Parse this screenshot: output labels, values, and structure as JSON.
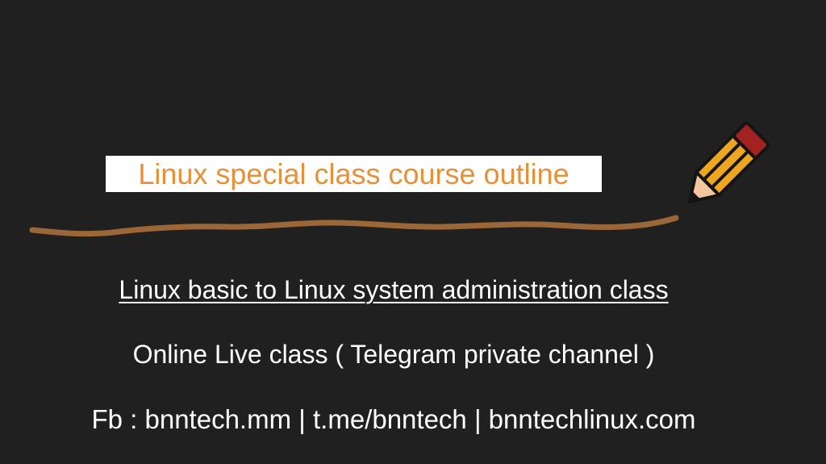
{
  "slide": {
    "title": "Linux special class course outline",
    "subtitle": "Linux basic to Linux system administration class",
    "live_class": "Online Live class ( Telegram private channel )",
    "contact": "Fb : bnntech.mm | t.me/bnntech | bnntechlinux.com"
  },
  "decorations": {
    "pencil": "pencil-icon",
    "stroke": "wavy-brush-stroke"
  },
  "colors": {
    "background": "#202020",
    "title_text": "#e69138",
    "title_background": "#ffffff",
    "stroke": "#9c6637",
    "pencil_body": "#f0a51f",
    "pencil_eraser": "#a3211e",
    "text": "#ffffff"
  }
}
